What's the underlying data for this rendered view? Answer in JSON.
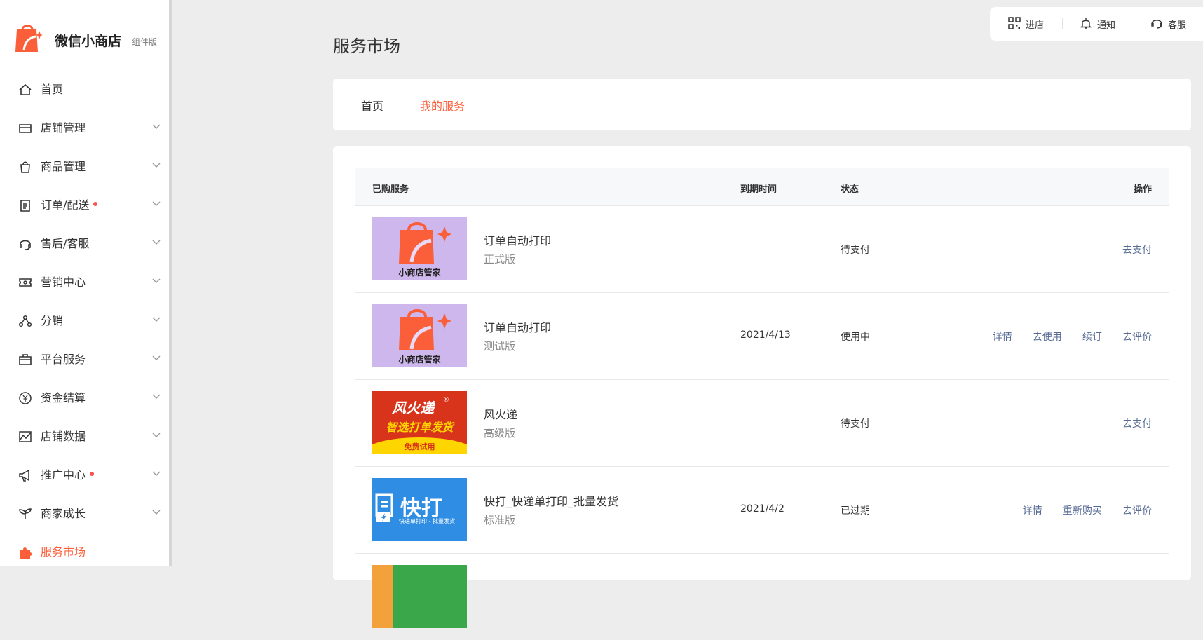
{
  "brand": {
    "name": "微信小商店",
    "tag": "组件版",
    "accent": "#fa5f39"
  },
  "sidebar": {
    "items": [
      {
        "label": "首页",
        "icon": "home-icon",
        "chevron": false,
        "dot": false
      },
      {
        "label": "店铺管理",
        "icon": "store-icon",
        "chevron": true,
        "dot": false
      },
      {
        "label": "商品管理",
        "icon": "shopping-bag-icon",
        "chevron": true,
        "dot": false
      },
      {
        "label": "订单/配送",
        "icon": "clipboard-icon",
        "chevron": true,
        "dot": true
      },
      {
        "label": "售后/客服",
        "icon": "headset-icon",
        "chevron": true,
        "dot": false
      },
      {
        "label": "营销中心",
        "icon": "ticket-icon",
        "chevron": true,
        "dot": false
      },
      {
        "label": "分销",
        "icon": "share-nodes-icon",
        "chevron": true,
        "dot": false
      },
      {
        "label": "平台服务",
        "icon": "briefcase-icon",
        "chevron": true,
        "dot": false
      },
      {
        "label": "资金结算",
        "icon": "yuan-icon",
        "chevron": true,
        "dot": false
      },
      {
        "label": "店铺数据",
        "icon": "chart-icon",
        "chevron": true,
        "dot": false
      },
      {
        "label": "推广中心",
        "icon": "megaphone-icon",
        "chevron": true,
        "dot": true
      },
      {
        "label": "商家成长",
        "icon": "sprout-icon",
        "chevron": true,
        "dot": false
      },
      {
        "label": "服务市场",
        "icon": "puzzle-icon",
        "chevron": false,
        "dot": false,
        "active": true
      }
    ]
  },
  "topbar": {
    "enter_store": "进店",
    "notify": "通知",
    "service": "客服"
  },
  "page": {
    "title": "服务市场"
  },
  "tabs": [
    {
      "label": "首页",
      "active": false
    },
    {
      "label": "我的服务",
      "active": true
    }
  ],
  "table": {
    "headers": {
      "service": "已购服务",
      "expire": "到期时间",
      "status": "状态",
      "actions": "操作"
    },
    "rows": [
      {
        "name": "订单自动打印",
        "version": "正式版",
        "expire": "",
        "status": "待支付",
        "actions": [
          "去支付"
        ],
        "thumb": {
          "style": "xiaodian",
          "caption": "小商店管家"
        }
      },
      {
        "name": "订单自动打印",
        "version": "测试版",
        "expire": "2021/4/13",
        "status": "使用中",
        "actions": [
          "详情",
          "去使用",
          "续订",
          "去评价"
        ],
        "thumb": {
          "style": "xiaodian",
          "caption": "小商店管家"
        }
      },
      {
        "name": "风火递",
        "version": "高级版",
        "expire": "",
        "status": "待支付",
        "actions": [
          "去支付"
        ],
        "thumb": {
          "style": "fenghuodi",
          "brand": "风火递",
          "slogan": "智选打单发货",
          "badge": "免费试用"
        }
      },
      {
        "name": "快打_快递单打印_批量发货",
        "version": "标准版",
        "expire": "2021/4/2",
        "status": "已过期",
        "actions": [
          "详情",
          "重新购买",
          "去评价"
        ],
        "thumb": {
          "style": "kuaida",
          "brand": "快打",
          "caption": "快递单打印 - 批量发货"
        }
      }
    ]
  }
}
